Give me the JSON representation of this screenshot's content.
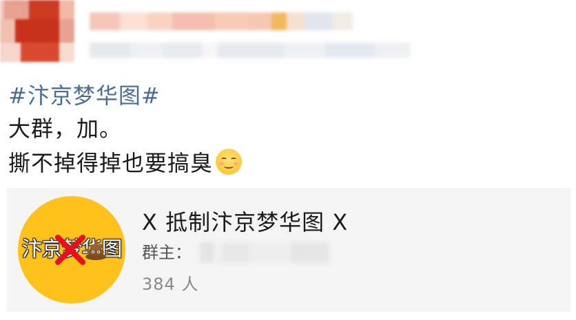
{
  "post": {
    "hashtag": "#汴京梦华图#",
    "lines": [
      "大群，加。",
      "撕不掉得掉也要搞臭"
    ],
    "trailing_emoji": "smiling-face-emoji"
  },
  "group_card": {
    "title": "X 抵制汴京梦华图 X",
    "owner_label": "群主：",
    "member_count": "384 人",
    "avatar": {
      "text": "汴京梦华图",
      "background_color": "#ffc21c",
      "overlay_icons": [
        "red-cross-icon",
        "poop-icon"
      ]
    }
  },
  "colors": {
    "hashtag": "#4a6d96",
    "body_text": "#1a1a1a",
    "card_background": "#f5f5f5",
    "secondary_text": "#888888"
  }
}
